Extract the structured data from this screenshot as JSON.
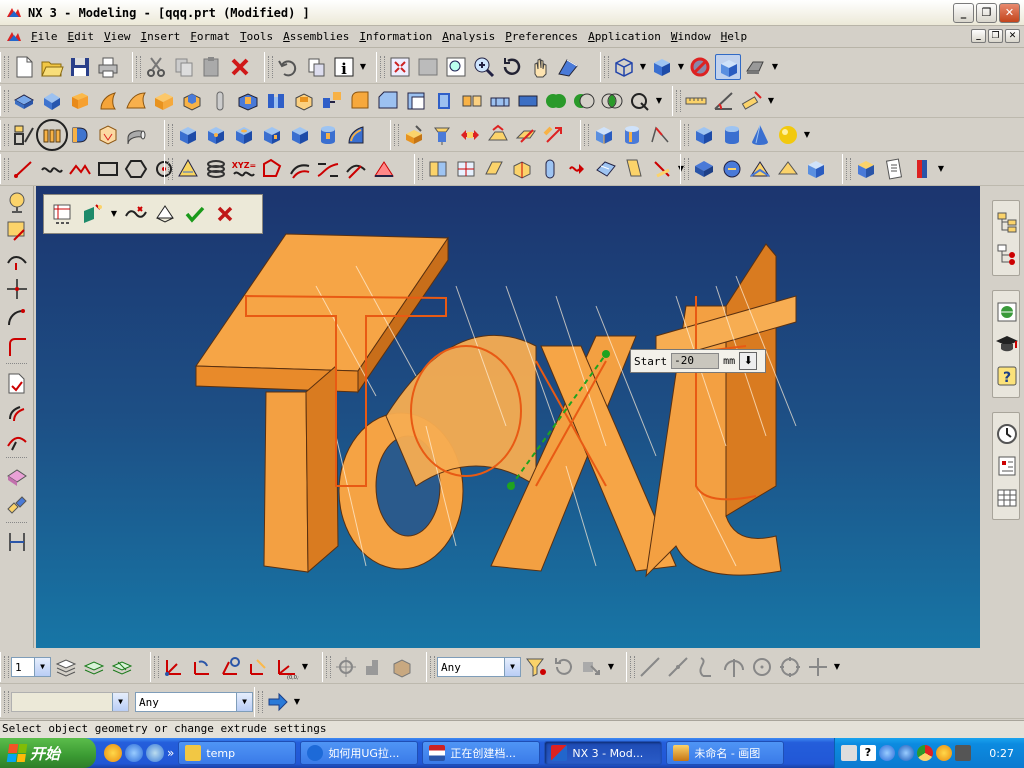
{
  "window": {
    "title": "NX 3 - Modeling - [qqq.prt (Modified) ]",
    "controls": [
      "_",
      "❐",
      "✕"
    ]
  },
  "menu": {
    "items": [
      "File",
      "Edit",
      "View",
      "Insert",
      "Format",
      "Tools",
      "Assemblies",
      "Information",
      "Analysis",
      "Preferences",
      "Application",
      "Window",
      "Help"
    ],
    "doc_controls": [
      "_",
      "❐",
      "✕"
    ]
  },
  "viewport": {
    "text_object": "Text",
    "start_label": "Start",
    "start_value": "-20",
    "start_unit": "mm"
  },
  "bottom": {
    "layer_value": "1",
    "filter_value": "Any",
    "selection_filter": "Any",
    "disabled_combo": ""
  },
  "status": {
    "message": "Select object geometry or change extrude settings"
  },
  "taskbar": {
    "start_label": "开始",
    "tasks": [
      {
        "label": "temp",
        "icon": "folder-icon"
      },
      {
        "label": "如何用UG拉...",
        "icon": "browser-icon"
      },
      {
        "label": "正在创建档...",
        "icon": "document-icon"
      },
      {
        "label": "NX 3 - Mod...",
        "icon": "nx-icon"
      },
      {
        "label": "未命名 - 画图",
        "icon": "paint-icon"
      }
    ],
    "clock": "0:27"
  },
  "colors": {
    "model_orange": "#f39a3a",
    "viewport_top": "#1c356f",
    "viewport_bottom": "#1776a6",
    "taskbar_blue": "#245edb"
  }
}
